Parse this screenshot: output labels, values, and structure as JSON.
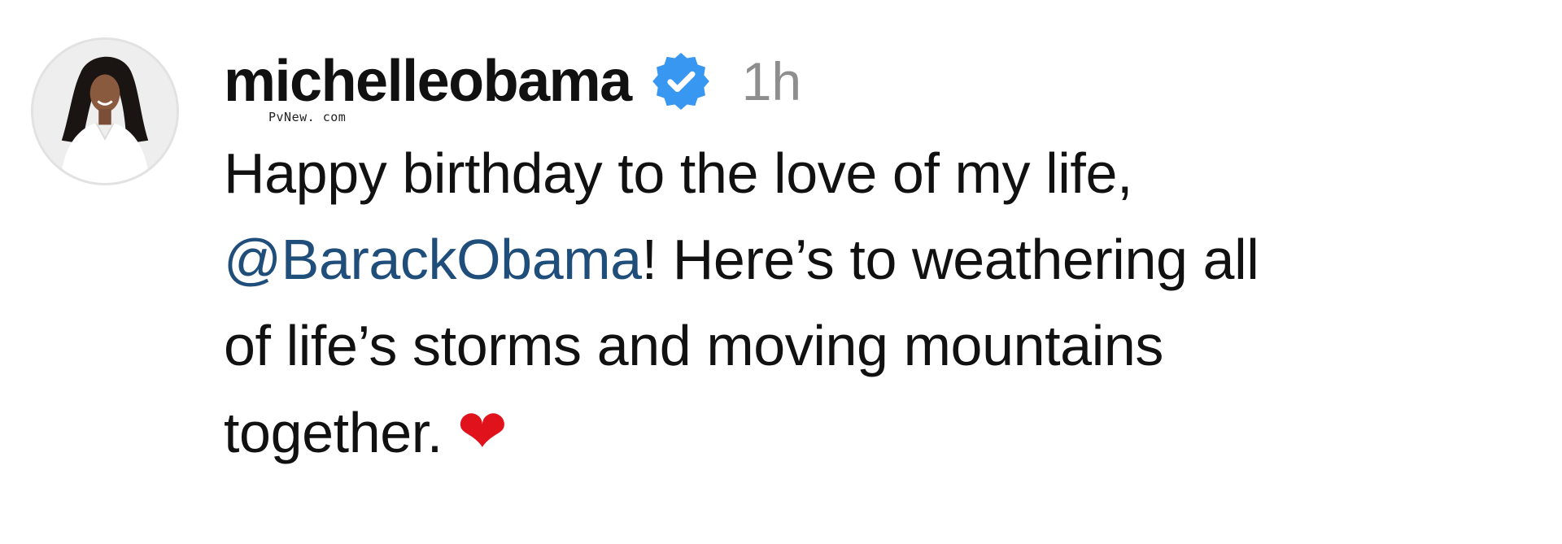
{
  "post": {
    "username": "michelleobama",
    "verified_icon": "verified-badge-icon",
    "timestamp": "1h",
    "watermark": "PvNew. com",
    "caption": {
      "line1": "Happy birthday to the love of my life,",
      "mention": "@BarackObama",
      "line2_rest": "! Here’s to weathering all",
      "line3": "of life’s storms and moving mountains",
      "line4": "together.",
      "emoji": "❤"
    }
  },
  "colors": {
    "verified_blue": "#3897f0",
    "mention_blue": "#1f4e7a",
    "timestamp_gray": "#8e8e8e",
    "heart_red": "#e0121b"
  }
}
